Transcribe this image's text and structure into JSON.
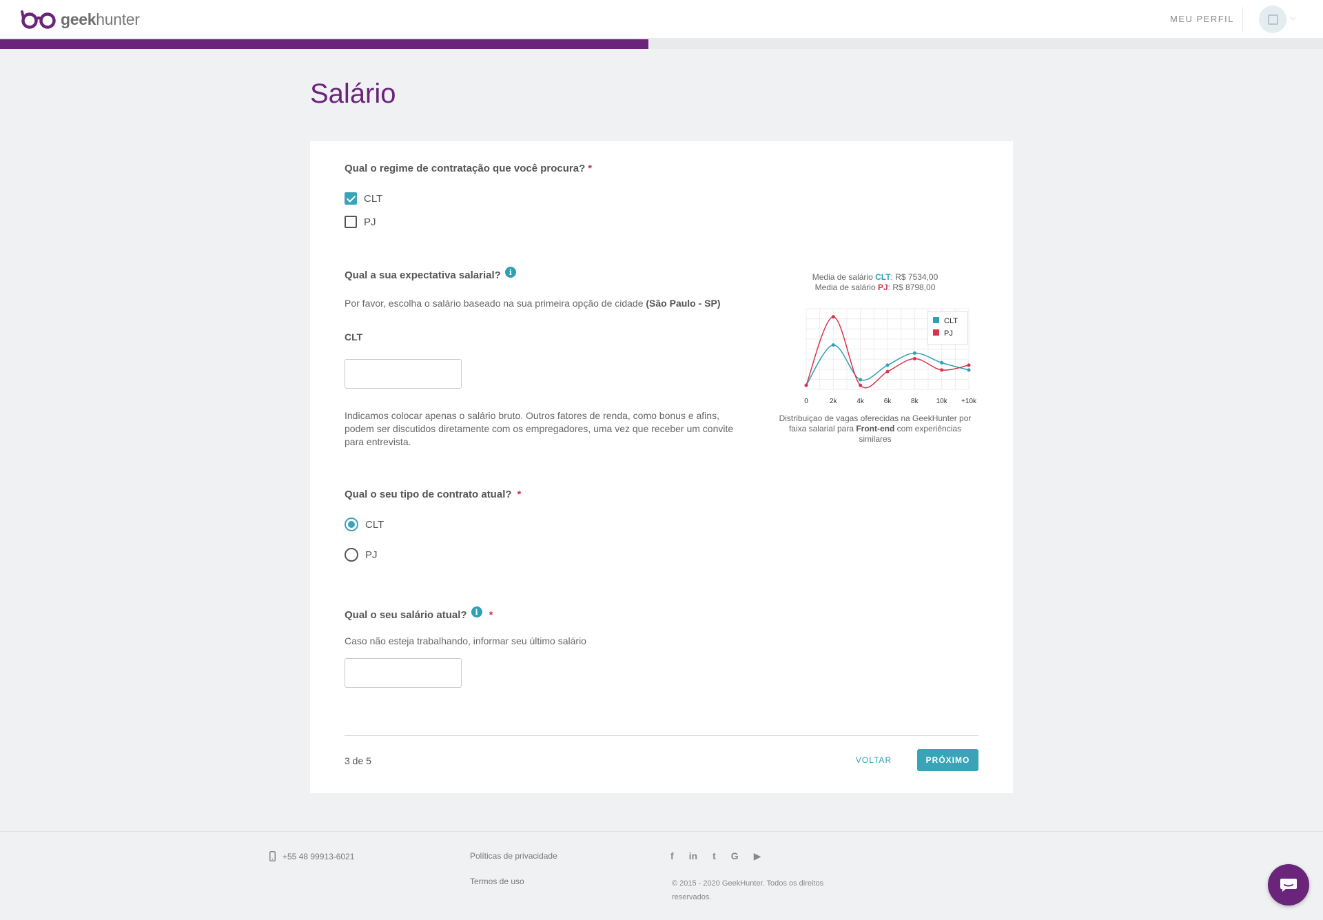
{
  "brand": {
    "name_bold": "geek",
    "name_rest": "hunter"
  },
  "nav": {
    "profile_label": "MEU PERFIL"
  },
  "progress": {
    "fraction": 0.49
  },
  "page": {
    "title": "Salário"
  },
  "q1": {
    "label": "Qual o regime de contratação que você procura?",
    "required": "*",
    "options": [
      {
        "label": "CLT",
        "checked": true
      },
      {
        "label": "PJ",
        "checked": false
      }
    ]
  },
  "q2": {
    "label": "Qual a sua expectativa salarial?",
    "info_icon": "i",
    "hint_prefix": "Por favor, escolha o salário baseado na sua primeira opção de cidade ",
    "hint_city": "(São Paulo - SP)",
    "field_label": "CLT",
    "field_value": "",
    "note": "Indicamos colocar apenas o salário bruto. Outros fatores de renda, como bonus e afins, podem ser discutidos diretamente com os empregadores, uma vez que receber um convite para entrevista."
  },
  "chart_caption": {
    "line1_prefix": "Media de salário ",
    "line1_type": "CLT",
    "line1_value": ": R$ 7534,00",
    "line2_prefix": "Media de salário ",
    "line2_type": "PJ",
    "line2_value": ": R$ 8798,00",
    "bottom_prefix": "Distribuiçao de vagas oferecidas na GeekHunter por faixa salarial para ",
    "bottom_role": "Front-end",
    "bottom_suffix": " com experiências similares"
  },
  "chart_data": {
    "type": "line",
    "categories": [
      "0",
      "2k",
      "4k",
      "6k",
      "8k",
      "10k",
      "+10k"
    ],
    "ylim": [
      0,
      100
    ],
    "series": [
      {
        "name": "CLT",
        "color": "#2fa0b5",
        "values": [
          5,
          55,
          12,
          30,
          45,
          33,
          24
        ]
      },
      {
        "name": "PJ",
        "color": "#d8334a",
        "values": [
          5,
          90,
          5,
          22,
          38,
          24,
          30
        ]
      }
    ],
    "legend": "top-right",
    "grid": true
  },
  "q3": {
    "label": "Qual o seu tipo de contrato atual?",
    "required": "*",
    "options": [
      {
        "label": "CLT",
        "checked": true
      },
      {
        "label": "PJ",
        "checked": false
      }
    ]
  },
  "q4": {
    "label": "Qual o seu salário atual?",
    "info_icon": "i",
    "required": "*",
    "hint": "Caso não esteja trabalhando, informar seu último salário",
    "field_value": ""
  },
  "footer_nav": {
    "step": "3 de 5",
    "back_label": "VOLTAR",
    "next_label": "PRÓXIMO"
  },
  "footer": {
    "phone": "+55 48 99913-6021",
    "privacy": "Políticas de privacidade",
    "terms": "Termos de uso",
    "social": [
      {
        "icon": "facebook-icon",
        "glyph": "f"
      },
      {
        "icon": "linkedin-icon",
        "glyph": "in"
      },
      {
        "icon": "twitter-icon",
        "glyph": "t"
      },
      {
        "icon": "google-icon",
        "glyph": "G"
      },
      {
        "icon": "youtube-icon",
        "glyph": "▶"
      }
    ],
    "copyright": "© 2015 - 2020 GeekHunter. Todos os direitos reservados."
  },
  "colors": {
    "brand": "#6a2479",
    "accent": "#3aa3b8",
    "required": "#d8334a"
  }
}
